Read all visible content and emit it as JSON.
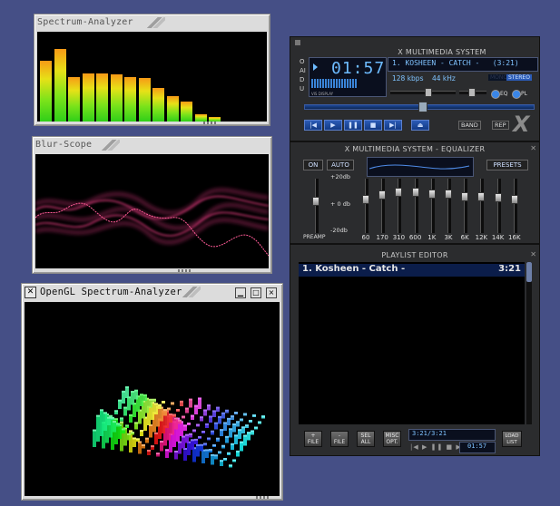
{
  "spectrum": {
    "title": "Spectrum-Analyzer",
    "bars": [
      0.74,
      0.89,
      0.55,
      0.59,
      0.59,
      0.58,
      0.54,
      0.53,
      0.41,
      0.31,
      0.24,
      0.09,
      0.06
    ]
  },
  "blur": {
    "title": "Blur-Scope"
  },
  "opengl": {
    "title": "OpenGL Spectrum-Analyzer",
    "minimize_label": "▁",
    "maximize_label": "□",
    "close_label": "×"
  },
  "player": {
    "title": "X MULTIMEDIA SYSTEM",
    "time": "01:57",
    "track_info": "1. KOSHEEN - CATCH -   (3:21)",
    "bitrate": "128 kbps",
    "samplerate": "44 kHz",
    "mode_mono": "MONO",
    "mode_stereo": "STEREO",
    "eq_toggle": "EQ",
    "pl_toggle": "PL",
    "vis_label": "VIS DISPLAY",
    "side_letters": "OAIDU",
    "band_label": "BAND",
    "rep_label": "REP",
    "logo": "X",
    "controls": [
      "prev",
      "play",
      "pause",
      "stop",
      "next",
      "eject"
    ]
  },
  "equalizer": {
    "title": "X MULTIMEDIA SYSTEM - EQUALIZER",
    "on_label": "ON",
    "auto_label": "AUTO",
    "presets_label": "PRESETS",
    "db_top": "+20db",
    "db_mid": "+ 0 db",
    "db_bottom": "-20db",
    "preamp_label": "PREAMP",
    "bands": [
      "60",
      "170",
      "310",
      "600",
      "1K",
      "3K",
      "6K",
      "12K",
      "14K",
      "16K"
    ]
  },
  "playlist": {
    "title": "PLAYLIST EDITOR",
    "items": [
      {
        "title": "1. Kosheen - Catch -",
        "duration": "3:21"
      }
    ],
    "buttons": [
      {
        "symbol": "+",
        "label": "FILE"
      },
      {
        "symbol": "-",
        "label": "FILE"
      },
      {
        "symbol": "SEL",
        "label": "ALL"
      },
      {
        "symbol": "MISC",
        "label": "OPT."
      }
    ],
    "load_list": "LOAD LIST",
    "time_info": "3:21/3:21",
    "mini_time": "01:57"
  }
}
